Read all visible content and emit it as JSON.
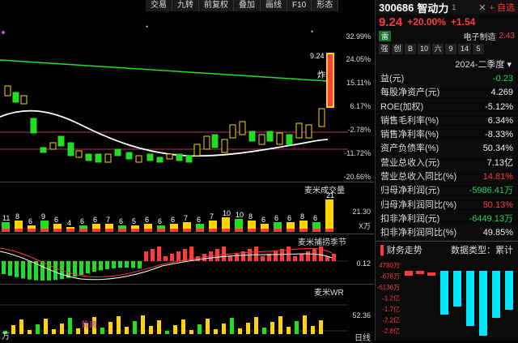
{
  "toolbar": {
    "items": [
      "交易",
      "九转",
      "前复权",
      "叠加",
      "画线",
      "F10",
      "形态"
    ]
  },
  "main_chart": {
    "y_ticks": [
      "32.99%",
      "24.05%",
      "15.11%",
      "6.17%",
      "-2.78%",
      "-11.72%",
      "-20.66%"
    ],
    "high_label": "9.24",
    "explode_label": "炸"
  },
  "volume_pane": {
    "title": "麦米成交量",
    "y_label_top": "21.30",
    "y_label_unit": "X万",
    "counts": [
      "11",
      "8",
      "6",
      "9",
      "6",
      "4",
      "6",
      "6",
      "7",
      "6",
      "5",
      "6",
      "6",
      "6",
      "7",
      "6",
      "7",
      "10",
      "10",
      "8",
      "6",
      "6",
      "6",
      "8",
      "6",
      "21"
    ]
  },
  "momentum_pane": {
    "title": "麦米捕捞季节",
    "y_label": "0.12"
  },
  "wr_pane": {
    "title": "麦米WR",
    "y_label": "52.36",
    "bottom_label": "万",
    "bottom_text": "背离",
    "date_label": "日线"
  },
  "stock": {
    "code": "300686",
    "name": "智动力",
    "price": "9.24",
    "change_pct": "+20.00%",
    "change_abs": "+1.54",
    "watch_button": "自选",
    "board_badge": "雷",
    "sector_prefix": "1",
    "sector": "电子制造",
    "sector_change": "2.43"
  },
  "tabs": [
    "强",
    "创",
    "B",
    "10",
    "六",
    "9",
    "14",
    "5"
  ],
  "period": "2024-二季度",
  "metrics": [
    {
      "label": "益(元)",
      "value": "-0.23",
      "color": "green"
    },
    {
      "label": "每股净资产(元)",
      "value": "4.269",
      "color": "white"
    },
    {
      "label": "ROE(加权)",
      "value": "-5.12%",
      "color": "white"
    },
    {
      "label": "销售毛利率(%)",
      "value": "6.34%",
      "color": "white"
    },
    {
      "label": "销售净利率(%)",
      "value": "-8.33%",
      "color": "white"
    },
    {
      "label": "资产负债率(%)",
      "value": "50.34%",
      "color": "white"
    },
    {
      "label": "营业总收入(元)",
      "value": "7.13亿",
      "color": "white"
    },
    {
      "label": "营业总收入同比(%)",
      "value": "14.81%",
      "color": "red"
    },
    {
      "label": "归母净利润(元)",
      "value": "-5986.41万",
      "color": "green"
    },
    {
      "label": "归母净利润同比(%)",
      "value": "50.13%",
      "color": "red"
    },
    {
      "label": "扣非净利润(元)",
      "value": "-6449.13万",
      "color": "green"
    },
    {
      "label": "扣非净利润同比(%)",
      "value": "49.85%",
      "color": "white"
    }
  ],
  "trend": {
    "title": "财务走势",
    "data_type": "数据类型：累计",
    "y_ticks": [
      "4780万",
      "-678万",
      "-6136万",
      "-1.2亿",
      "-1.7亿",
      "-2.2亿",
      "-2.8亿"
    ]
  }
}
